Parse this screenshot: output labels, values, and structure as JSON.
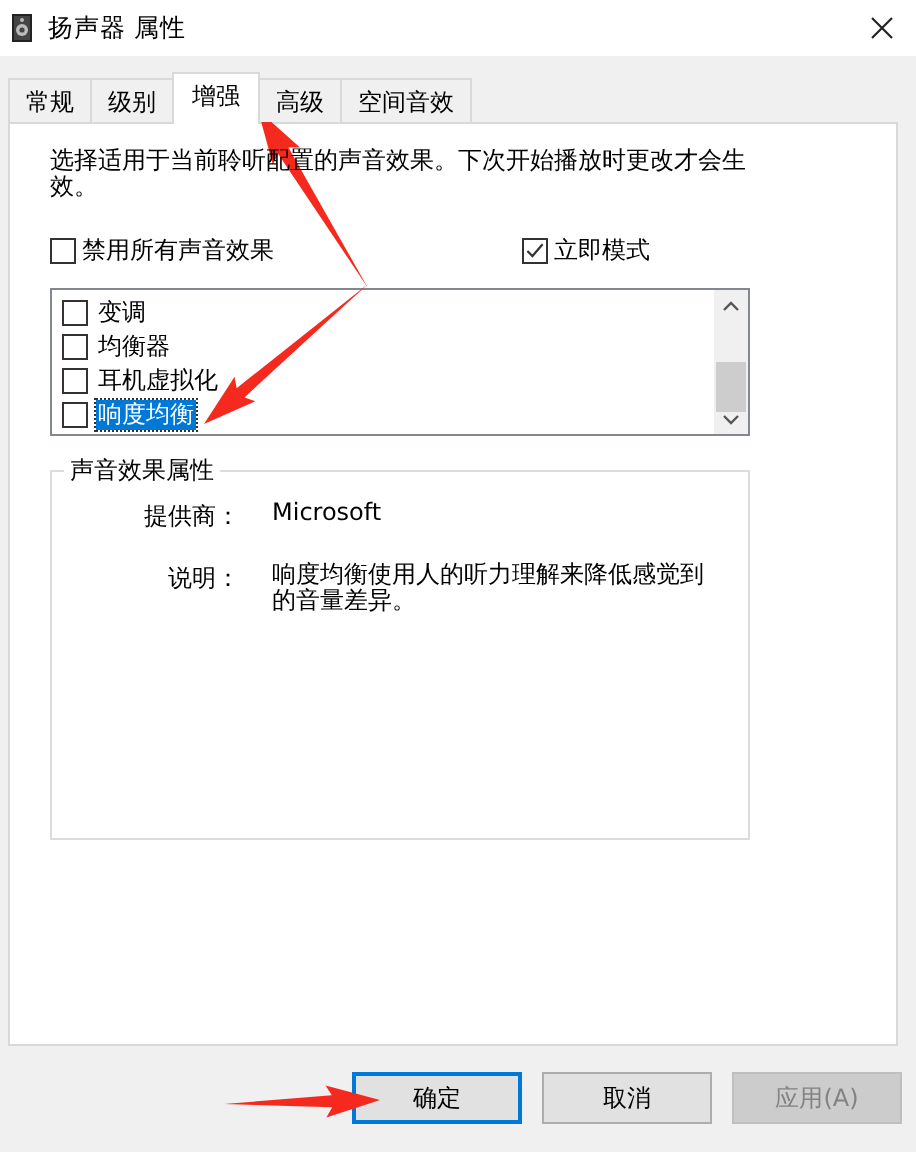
{
  "window": {
    "title": "扬声器 属性"
  },
  "tabs": [
    {
      "label": "常规",
      "selected": false
    },
    {
      "label": "级别",
      "selected": false
    },
    {
      "label": "增强",
      "selected": true
    },
    {
      "label": "高级",
      "selected": false
    },
    {
      "label": "空间音效",
      "selected": false
    }
  ],
  "description": "选择适用于当前聆听配置的声音效果。下次开始播放时更改才会生效。",
  "options": [
    {
      "label": "禁用所有声音效果",
      "checked": false
    },
    {
      "label": "立即模式",
      "checked": true
    }
  ],
  "effects": [
    {
      "label": "变调",
      "checked": false,
      "selected": false
    },
    {
      "label": "均衡器",
      "checked": false,
      "selected": false
    },
    {
      "label": "耳机虚拟化",
      "checked": false,
      "selected": false
    },
    {
      "label": "响度均衡",
      "checked": false,
      "selected": true
    }
  ],
  "properties": {
    "title": "声音效果属性",
    "rows": [
      {
        "label": "提供商：",
        "value": "Microsoft"
      },
      {
        "label": "说明：",
        "value": "响度均衡使用人的听力理解来降低感觉到的音量差异。"
      }
    ]
  },
  "buttons": [
    {
      "label": "确定",
      "default": true,
      "disabled": false
    },
    {
      "label": "取消",
      "default": false,
      "disabled": false
    },
    {
      "label": "应用(A)",
      "default": false,
      "disabled": true
    }
  ]
}
